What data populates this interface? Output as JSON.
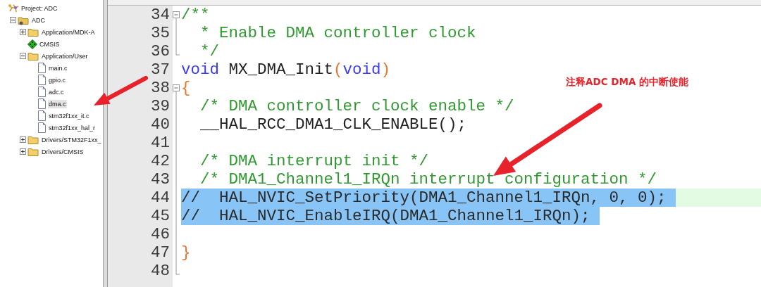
{
  "project_tree": {
    "label": "Project: ADC",
    "kind": "project",
    "selected": false,
    "children": [
      {
        "label": "ADC",
        "kind": "target",
        "expanded": true,
        "selected": false,
        "children": [
          {
            "label": "Application/MDK-A",
            "kind": "folder",
            "expanded": false,
            "selected": false
          },
          {
            "label": "CMSIS",
            "kind": "component",
            "selected": false
          },
          {
            "label": "Application/User",
            "kind": "folder",
            "expanded": true,
            "selected": false,
            "children": [
              {
                "label": "main.c",
                "kind": "file",
                "selected": false
              },
              {
                "label": "gpio.c",
                "kind": "file",
                "selected": false
              },
              {
                "label": "adc.c",
                "kind": "file",
                "selected": false
              },
              {
                "label": "dma.c",
                "kind": "file",
                "selected": true
              },
              {
                "label": "stm32f1xx_it.c",
                "kind": "file",
                "selected": false
              },
              {
                "label": "stm32f1xx_hal_r",
                "kind": "file",
                "selected": false
              }
            ]
          },
          {
            "label": "Drivers/STM32F1xx_",
            "kind": "folder",
            "expanded": false,
            "selected": false
          },
          {
            "label": "Drivers/CMSIS",
            "kind": "folder",
            "expanded": false,
            "selected": false
          }
        ]
      }
    ]
  },
  "editor": {
    "lines": [
      {
        "number": "34",
        "fold_open": true,
        "fold_close": false,
        "in_fold": false,
        "selected": false,
        "current": false,
        "tokens": [
          {
            "kind": "comment",
            "text": "/**"
          }
        ]
      },
      {
        "number": "35",
        "fold_open": false,
        "fold_close": false,
        "in_fold": true,
        "selected": false,
        "current": false,
        "tokens": [
          {
            "kind": "comment",
            "text": "  * Enable DMA controller clock"
          }
        ]
      },
      {
        "number": "36",
        "fold_open": false,
        "fold_close": true,
        "in_fold": true,
        "selected": false,
        "current": false,
        "tokens": [
          {
            "kind": "comment",
            "text": "  */"
          }
        ]
      },
      {
        "number": "37",
        "fold_open": false,
        "fold_close": false,
        "in_fold": false,
        "selected": false,
        "current": false,
        "tokens": [
          {
            "kind": "keyword",
            "text": "void"
          },
          {
            "kind": "plain",
            "text": " MX_DMA_Init"
          },
          {
            "kind": "punct",
            "text": "("
          },
          {
            "kind": "keyword",
            "text": "void"
          },
          {
            "kind": "punct",
            "text": ")"
          }
        ]
      },
      {
        "number": "38",
        "fold_open": true,
        "fold_close": false,
        "in_fold": false,
        "selected": false,
        "current": false,
        "tokens": [
          {
            "kind": "punct",
            "text": "{"
          }
        ]
      },
      {
        "number": "39",
        "fold_open": false,
        "fold_close": false,
        "in_fold": true,
        "selected": false,
        "current": false,
        "tokens": [
          {
            "kind": "comment",
            "text": "  /* DMA controller clock enable */"
          }
        ]
      },
      {
        "number": "40",
        "fold_open": false,
        "fold_close": false,
        "in_fold": true,
        "selected": false,
        "current": false,
        "tokens": [
          {
            "kind": "plain",
            "text": "  __HAL_RCC_DMA1_CLK_ENABLE();"
          }
        ]
      },
      {
        "number": "41",
        "fold_open": false,
        "fold_close": false,
        "in_fold": true,
        "selected": false,
        "current": false
      },
      {
        "number": "42",
        "fold_open": false,
        "fold_close": false,
        "in_fold": true,
        "selected": false,
        "current": false,
        "tokens": [
          {
            "kind": "comment",
            "text": "  /* DMA interrupt init */"
          }
        ]
      },
      {
        "number": "43",
        "fold_open": false,
        "fold_close": false,
        "in_fold": true,
        "selected": false,
        "current": false,
        "tokens": [
          {
            "kind": "comment",
            "text": "  /* DMA1_Channel1_IRQn interrupt configuration */"
          }
        ]
      },
      {
        "number": "44",
        "fold_open": false,
        "fold_close": false,
        "in_fold": true,
        "selected": true,
        "current": true,
        "tokens": [
          {
            "kind": "comment",
            "text": "//  HAL_NVIC_SetPriority(DMA1_Channel1_IRQn, 0, 0);"
          }
        ]
      },
      {
        "number": "45",
        "fold_open": false,
        "fold_close": false,
        "in_fold": true,
        "selected": true,
        "current": false,
        "tokens": [
          {
            "kind": "comment",
            "text": "//  HAL_NVIC_EnableIRQ(DMA1_Channel1_IRQn);"
          }
        ]
      },
      {
        "number": "46",
        "fold_open": false,
        "fold_close": false,
        "in_fold": true,
        "selected": false,
        "current": false
      },
      {
        "number": "47",
        "fold_open": false,
        "fold_close": false,
        "in_fold": true,
        "selected": false,
        "current": false,
        "tokens": [
          {
            "kind": "punct",
            "text": "}"
          }
        ]
      },
      {
        "number": "48",
        "fold_open": false,
        "fold_close": true,
        "in_fold": true,
        "selected": false,
        "current": false
      }
    ]
  },
  "annotation": {
    "label": "注释ADC DMA 的中断使能"
  }
}
